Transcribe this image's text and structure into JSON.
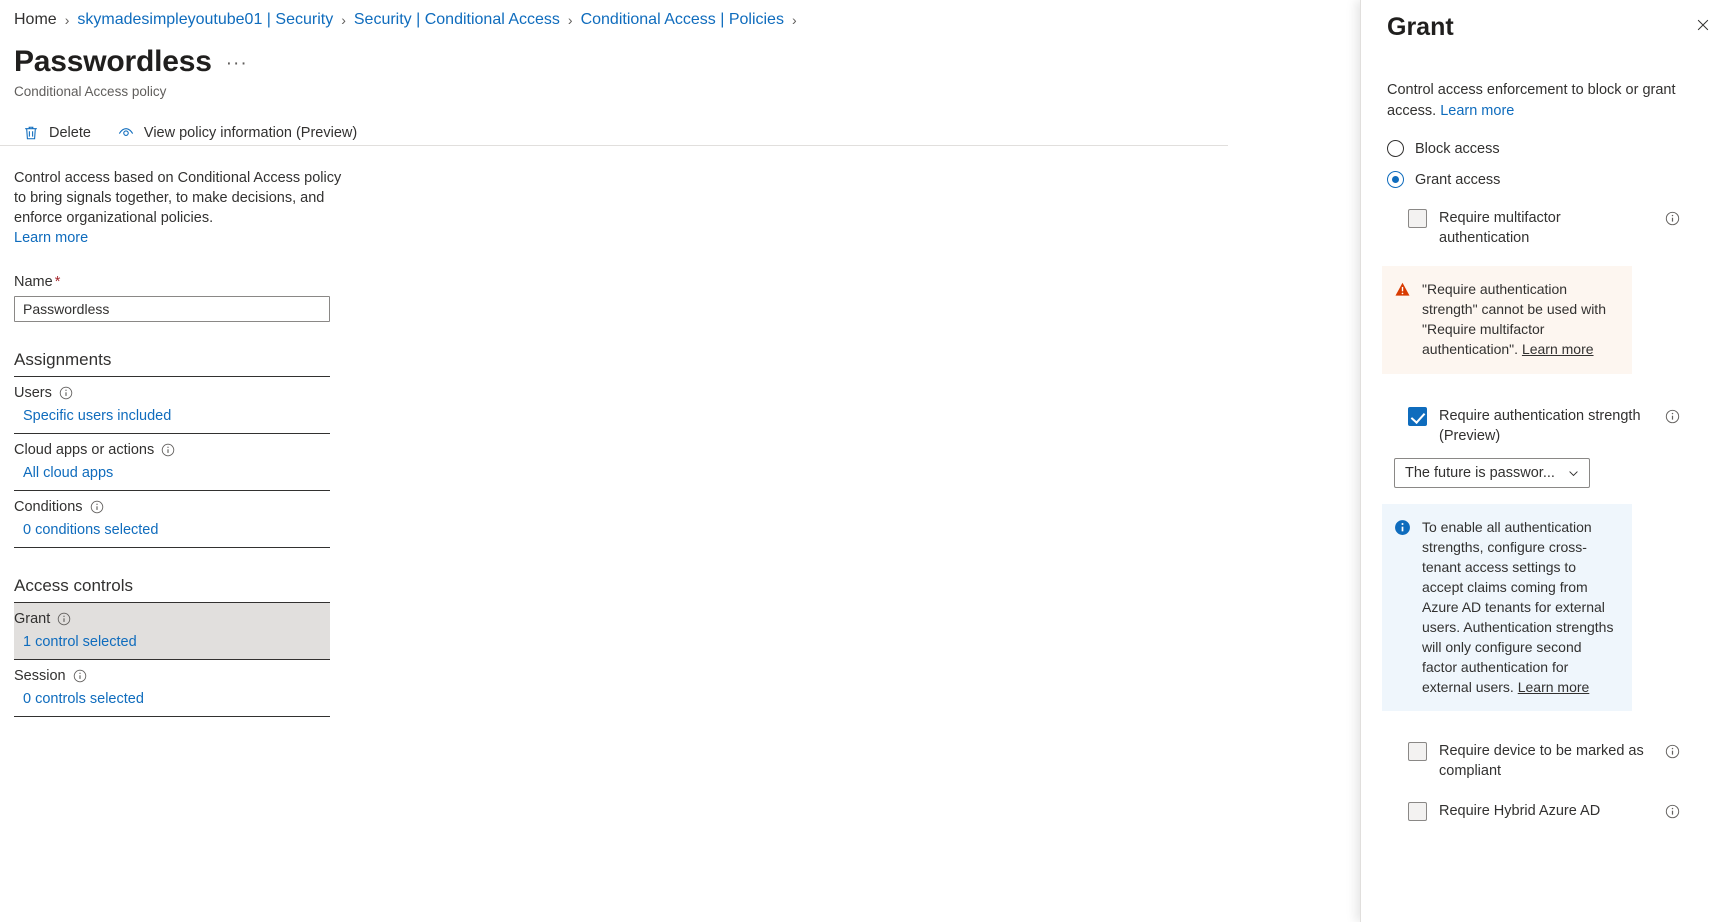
{
  "breadcrumb": {
    "items": [
      {
        "label": "Home",
        "current": true
      },
      {
        "label": "skymadesimpleyoutube01 | Security"
      },
      {
        "label": "Security | Conditional Access"
      },
      {
        "label": "Conditional Access | Policies"
      }
    ],
    "separator": "›"
  },
  "header": {
    "title": "Passwordless",
    "ellipsis": "···",
    "subtitle": "Conditional Access policy"
  },
  "toolbar": {
    "delete_label": "Delete",
    "view_policy_label": "View policy information (Preview)",
    "delete_icon": "trash-icon",
    "view_icon": "eye-icon"
  },
  "main": {
    "intro_text": "Control access based on Conditional Access policy to bring signals together, to make decisions, and enforce organizational policies.",
    "intro_link": "Learn more",
    "name_label": "Name",
    "name_required_mark": "*",
    "name_value": "Passwordless",
    "name_placeholder": "Name",
    "assignments_heading": "Assignments",
    "access_controls_heading": "Access controls",
    "rows": [
      {
        "label": "Users",
        "value": "Specific users included",
        "highlight": false
      },
      {
        "label": "Cloud apps or actions",
        "value": "All cloud apps",
        "highlight": false
      },
      {
        "label": "Conditions",
        "value": "0 conditions selected",
        "highlight": false
      },
      {
        "label": "Grant",
        "value": "1 control selected",
        "highlight": true
      },
      {
        "label": "Session",
        "value": "0 controls selected",
        "highlight": false
      }
    ]
  },
  "panel": {
    "title": "Grant",
    "close_icon": "close-icon",
    "description_text": "Control access enforcement to block or grant access. ",
    "description_link": "Learn more",
    "radios": [
      {
        "label": "Block access",
        "checked": false
      },
      {
        "label": "Grant access",
        "checked": true
      }
    ],
    "mfa_checkbox": {
      "label": "Require multifactor authentication",
      "checked": false
    },
    "warning": {
      "text": "\"Require authentication strength\" cannot be used with \"Require multifactor authentication\". ",
      "link": "Learn more",
      "icon": "warning-icon",
      "bg_color": "#fdf6f0",
      "icon_color": "#d83b01"
    },
    "auth_strength_checkbox": {
      "label": "Require authentication strength (Preview)",
      "checked": true
    },
    "auth_strength_dropdown": {
      "value": "The future is passwor...",
      "chevron_icon": "chevron-down-icon"
    },
    "info": {
      "text": "To enable all authentication strengths, configure cross-tenant access settings to accept claims coming from Azure AD tenants for external users. Authentication strengths will only configure second factor authentication for external users. ",
      "link": "Learn more",
      "icon": "info-filled-icon",
      "bg_color": "#eff6fc",
      "icon_color": "#0f6cbd"
    },
    "device_checkbox": {
      "label": "Require device to be marked as compliant",
      "checked": false
    },
    "hybrid_checkbox": {
      "label": "Require Hybrid Azure AD",
      "checked": false
    }
  },
  "colors": {
    "accent": "#0f6cbd",
    "highlight_row": "#e1dfdd",
    "required_star": "#a4262c"
  }
}
